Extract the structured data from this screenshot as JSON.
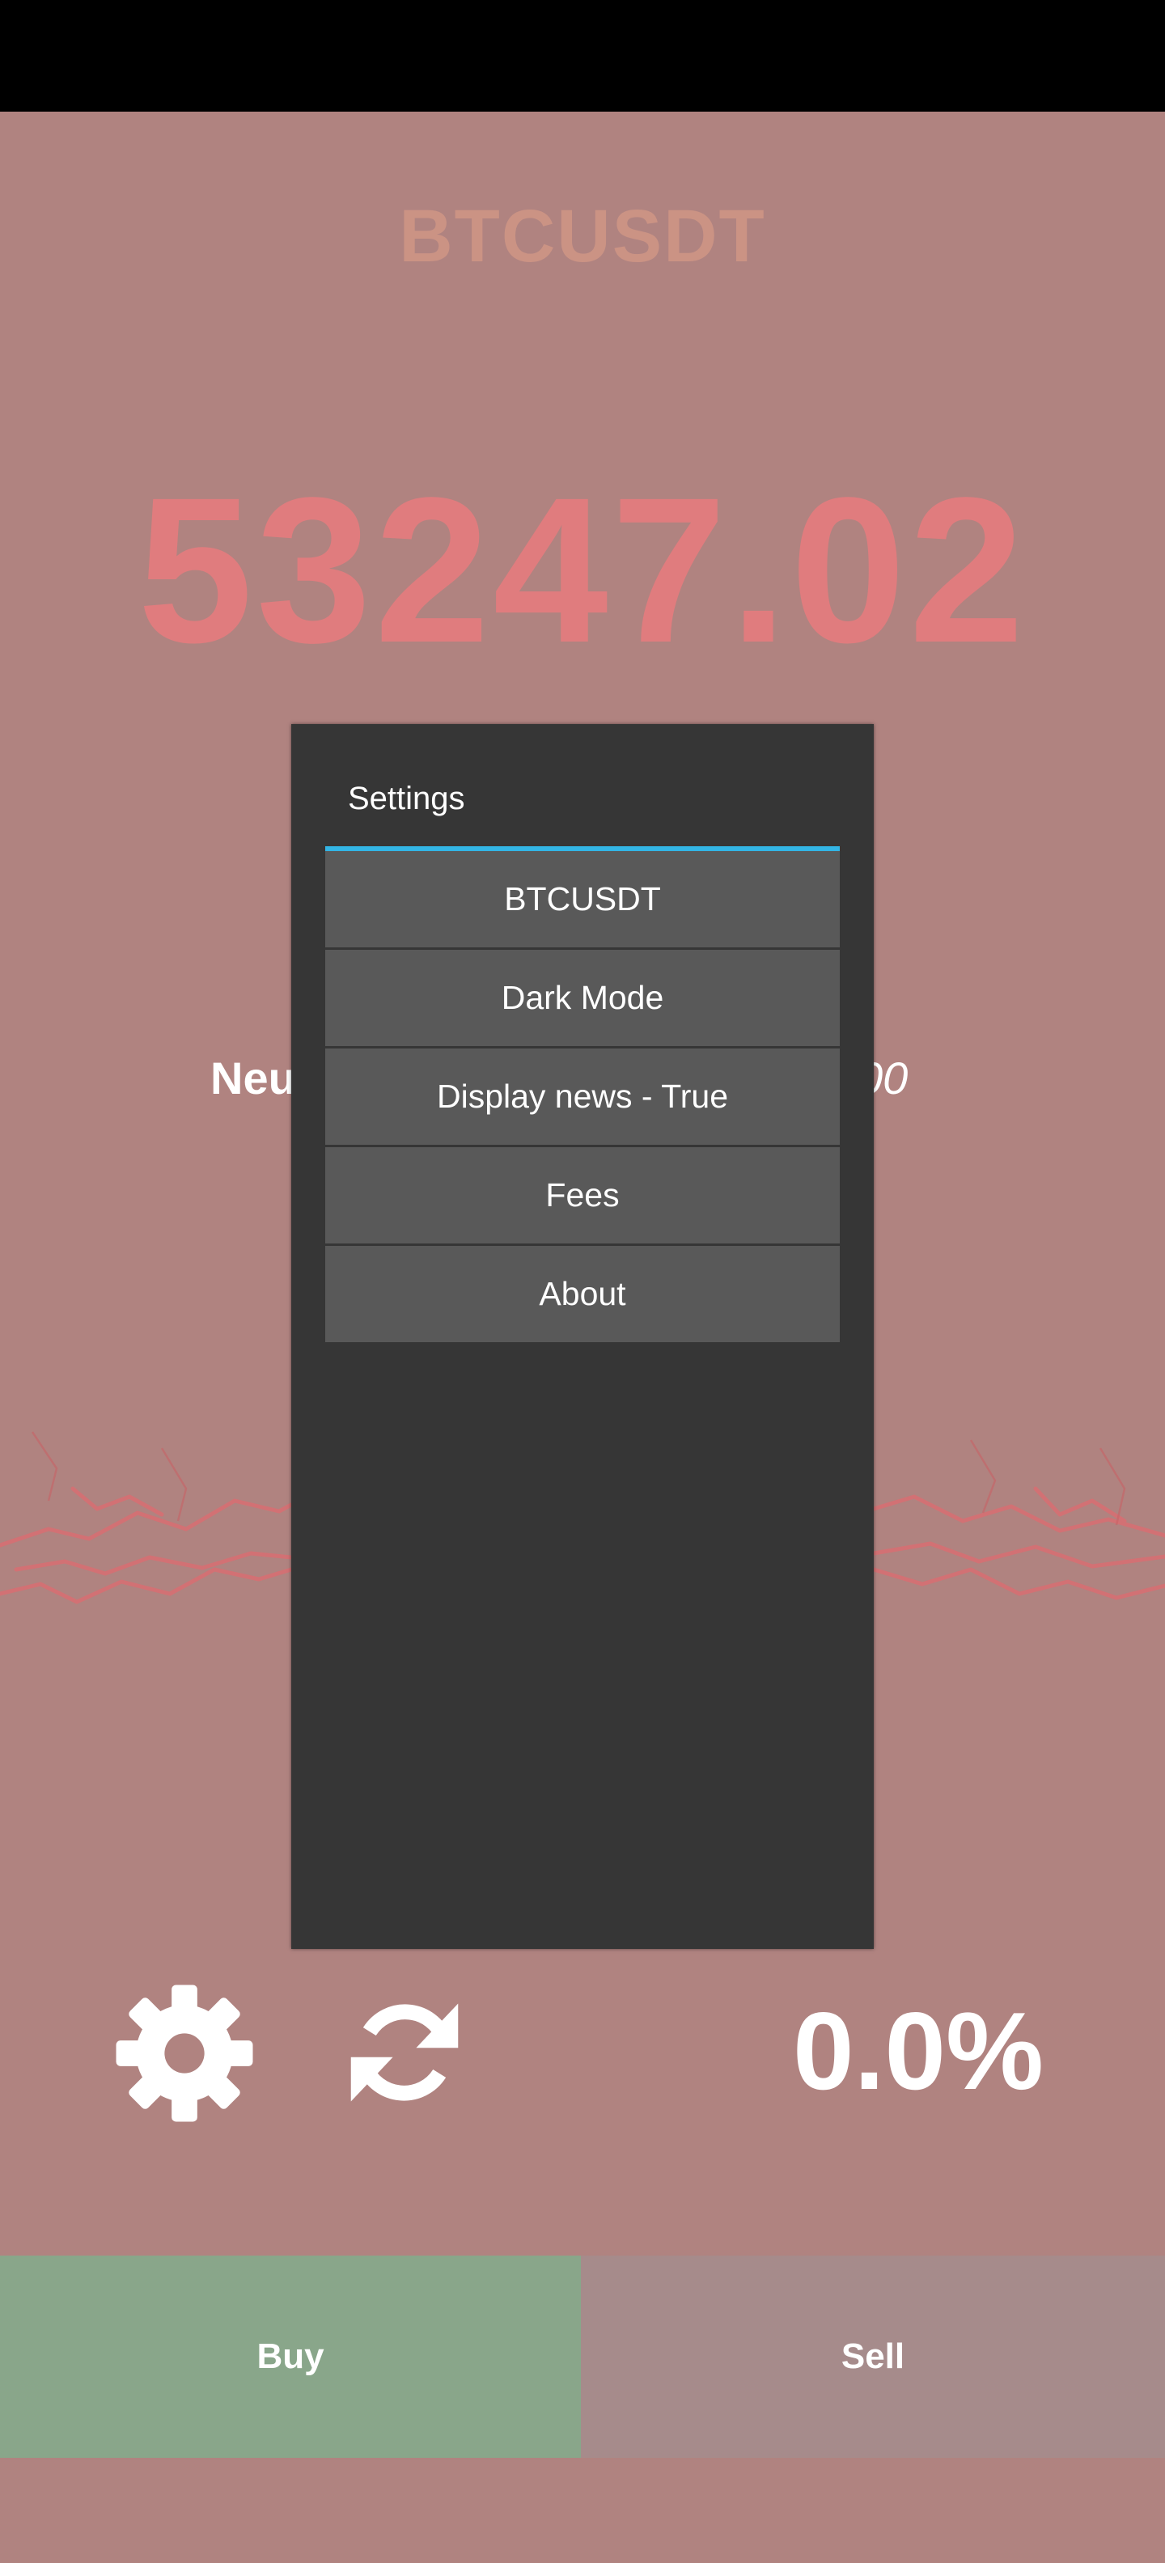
{
  "app": {
    "pair_title": "BTCUSDT",
    "price": "53247.02",
    "news_label_visible": "Neu",
    "news_value_visible": "00",
    "percent_change": "0.0%"
  },
  "actions": {
    "buy_label": "Buy",
    "sell_label": "Sell"
  },
  "icons": {
    "settings": "gear-icon",
    "refresh": "refresh-icon"
  },
  "dialog": {
    "title": "Settings",
    "items": [
      {
        "label": "BTCUSDT"
      },
      {
        "label": "Dark Mode"
      },
      {
        "label": "Display news - True"
      },
      {
        "label": "Fees"
      },
      {
        "label": "About"
      }
    ]
  },
  "colors": {
    "background": "#b08380",
    "status_bar": "#000000",
    "title": "#cb9384",
    "price": "#e07c7e",
    "buy": "#89a68a",
    "sell": "#a68b8b",
    "dialog_bg": "#363636",
    "dialog_item": "#595959",
    "dialog_accent": "#33b5e5"
  }
}
